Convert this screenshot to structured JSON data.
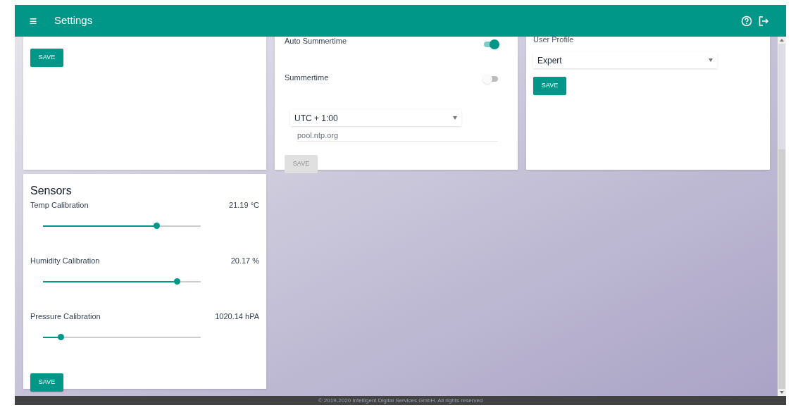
{
  "header": {
    "menu_icon": "≡",
    "title": "Settings"
  },
  "general_card": {
    "save_button": {
      "label": "SAVE",
      "disabled": false
    }
  },
  "time_card": {
    "toggles": [
      {
        "label": "Auto Summertime",
        "on": true
      },
      {
        "label": "Summertime",
        "on": false
      }
    ],
    "timezone": {
      "value": "UTC + 1:00"
    },
    "ntp_server": {
      "value": "pool.ntp.org"
    },
    "save_button": {
      "label": "SAVE",
      "disabled": true
    }
  },
  "profile_card": {
    "label": "User Profile",
    "select": {
      "value": "Expert"
    },
    "save_button": {
      "label": "SAVE",
      "disabled": false
    }
  },
  "sensors_card": {
    "title": "Sensors",
    "sliders": [
      {
        "label": "Temp Calibration",
        "reading": "21.19 °C",
        "level": 0.72
      },
      {
        "label": "Humidity Calibration",
        "reading": "20.17 %",
        "level": 0.85
      },
      {
        "label": "Pressure Calibration",
        "reading": "1020.14 hPA",
        "level": 0.11
      }
    ],
    "save_button": {
      "label": "SAVE",
      "disabled": false
    }
  },
  "footer": {
    "text": "© 2019-2020 Intelligent Digital Services GmbH. All rights reserved"
  }
}
